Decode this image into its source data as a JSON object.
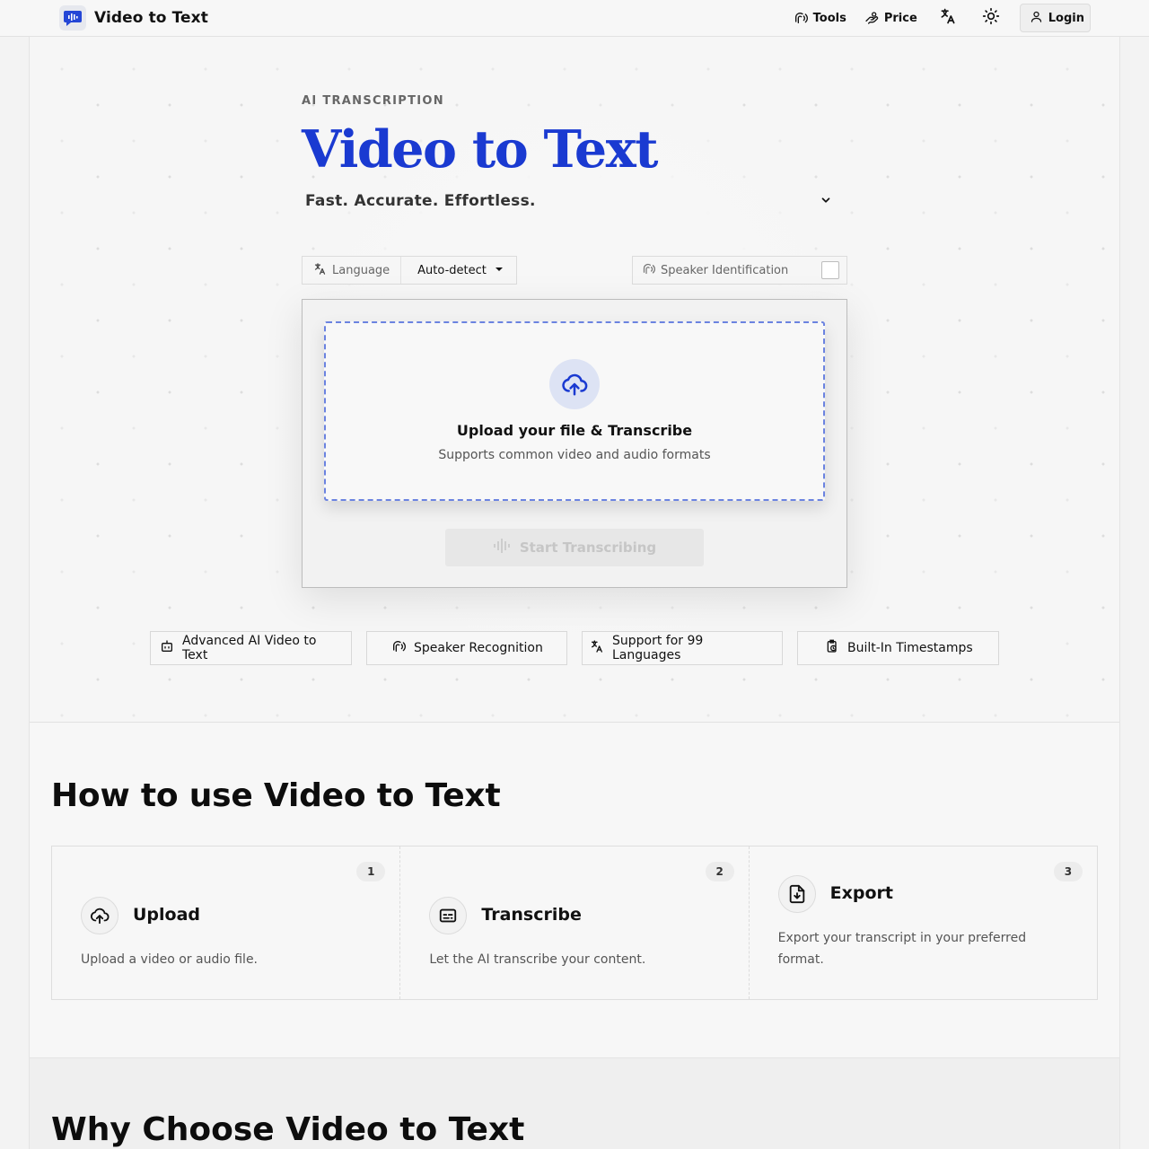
{
  "brand": {
    "name": "Video to Text",
    "logo_icon": "chat-waveform-icon",
    "accent": "#1a3ad1"
  },
  "nav": {
    "tools_label": "Tools",
    "price_label": "Price",
    "language_icon": "translate-icon",
    "theme_icon": "sun-icon",
    "login_label": "Login"
  },
  "hero": {
    "eyebrow": "AI TRANSCRIPTION",
    "title": "Video to Text",
    "subtitle": "Fast. Accurate. Effortless."
  },
  "options": {
    "language_label": "Language",
    "language_value": "Auto-detect",
    "speaker_label": "Speaker Identification",
    "speaker_checked": false
  },
  "upload": {
    "title": "Upload your file & Transcribe",
    "subtitle": "Supports common video and audio formats",
    "start_label": "Start Transcribing"
  },
  "features": [
    {
      "label": "Advanced AI Video to Text",
      "icon": "bot-icon"
    },
    {
      "label": "Speaker Recognition",
      "icon": "speaker-icon"
    },
    {
      "label": "Support for 99 Languages",
      "icon": "translate-icon"
    },
    {
      "label": "Built-In Timestamps",
      "icon": "clipboard-clock-icon"
    }
  ],
  "how": {
    "title": "How to use Video to Text",
    "steps": [
      {
        "num": "1",
        "title": "Upload",
        "desc": "Upload a video or audio file.",
        "icon": "cloud-upload-icon"
      },
      {
        "num": "2",
        "title": "Transcribe",
        "desc": "Let the AI transcribe your content.",
        "icon": "captions-icon"
      },
      {
        "num": "3",
        "title": "Export",
        "desc": "Export your transcript in your preferred format.",
        "icon": "file-download-icon"
      }
    ]
  },
  "why": {
    "title": "Why Choose Video to Text"
  }
}
